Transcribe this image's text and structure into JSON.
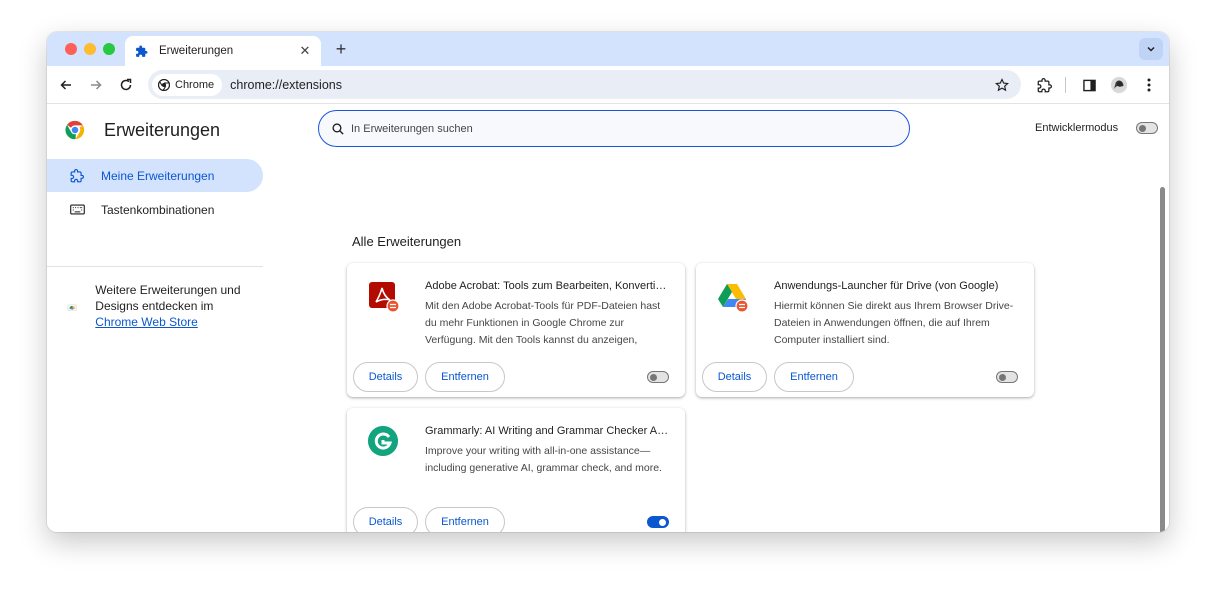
{
  "colors": {
    "accent": "#0b57d0",
    "tabstrip": "#d3e3fd",
    "nav_active": "#d3e3fd"
  },
  "tab": {
    "title": "Erweiterungen",
    "icon": "puzzle-icon"
  },
  "toolbar": {
    "chip_label": "Chrome",
    "url": "chrome://extensions"
  },
  "page": {
    "title": "Erweiterungen",
    "search_placeholder": "In Erweiterungen suchen",
    "dev_mode_label": "Entwicklermodus",
    "dev_mode_on": false
  },
  "sidebar": {
    "items": [
      {
        "label": "Meine Erweiterungen",
        "icon": "extension-icon",
        "active": true
      },
      {
        "label": "Tastenkombinationen",
        "icon": "keyboard-icon",
        "active": false
      }
    ],
    "webstore_text": "Weitere Erweiterungen und Designs entdecken im",
    "webstore_link": "Chrome Web Store"
  },
  "section_title": "Alle Erweiterungen",
  "buttons": {
    "details": "Details",
    "remove": "Entfernen"
  },
  "extensions": [
    {
      "name": "Adobe Acrobat: Tools zum Bearbeiten, Konvertieren und Signieren von PDFs",
      "description": "Mit den Adobe Acrobat-Tools für PDF-Dateien hast du mehr Funktionen in Google Chrome zur Verfügung. Mit den Tools kannst du anzeigen,",
      "icon": "adobe-acrobat-icon",
      "enabled": false
    },
    {
      "name": "Anwendungs-Launcher für Drive (von Google)",
      "description": "Hiermit können Sie direkt aus Ihrem Browser Drive-Dateien in Anwendungen öffnen, die auf Ihrem Computer installiert sind.",
      "icon": "google-drive-icon",
      "enabled": false
    },
    {
      "name": "Grammarly: AI Writing and Grammar Checker App",
      "description": "Improve your writing with all-in-one assistance—including generative AI, grammar check, and more.",
      "icon": "grammarly-icon",
      "enabled": true
    }
  ]
}
